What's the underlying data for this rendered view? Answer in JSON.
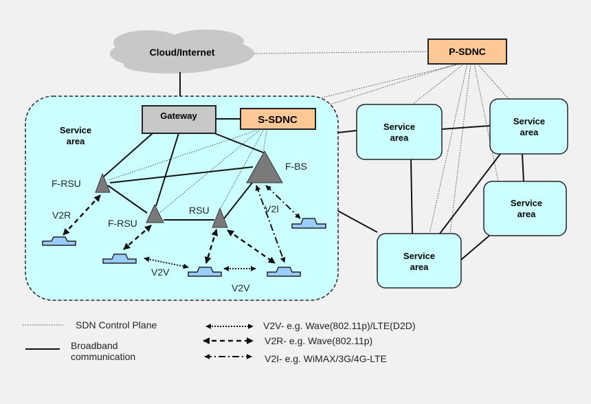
{
  "nodes": {
    "cloud": "Cloud/Internet",
    "p_sdnc": "P-SDNC",
    "gateway": "Gateway",
    "s_sdnc": "S-SDNC",
    "service_area_line1": "Service",
    "service_area_line2": "area",
    "f_rsu": "F-RSU",
    "rsu": "RSU",
    "f_bs": "F-BS"
  },
  "link_labels": {
    "v2r": "V2R",
    "v2i": "V2I",
    "v2v": "V2V"
  },
  "legend": {
    "sdn": "SDN Control Plane",
    "broadband_line1": "Broadband",
    "broadband_line2": "communication",
    "v2v": "V2V- e.g. Wave(802.11p)/LTE(D2D)",
    "v2r": "V2R- e.g. Wave(802.11p)",
    "v2i": "V2I- e.g. WiMAX/3G/4G-LTE"
  },
  "colors": {
    "service_area": "#ccffff",
    "controller": "#fdc896",
    "gateway": "#c8c8c8",
    "vehicle": "#99ccff",
    "cloud": "#c8c8c8"
  }
}
